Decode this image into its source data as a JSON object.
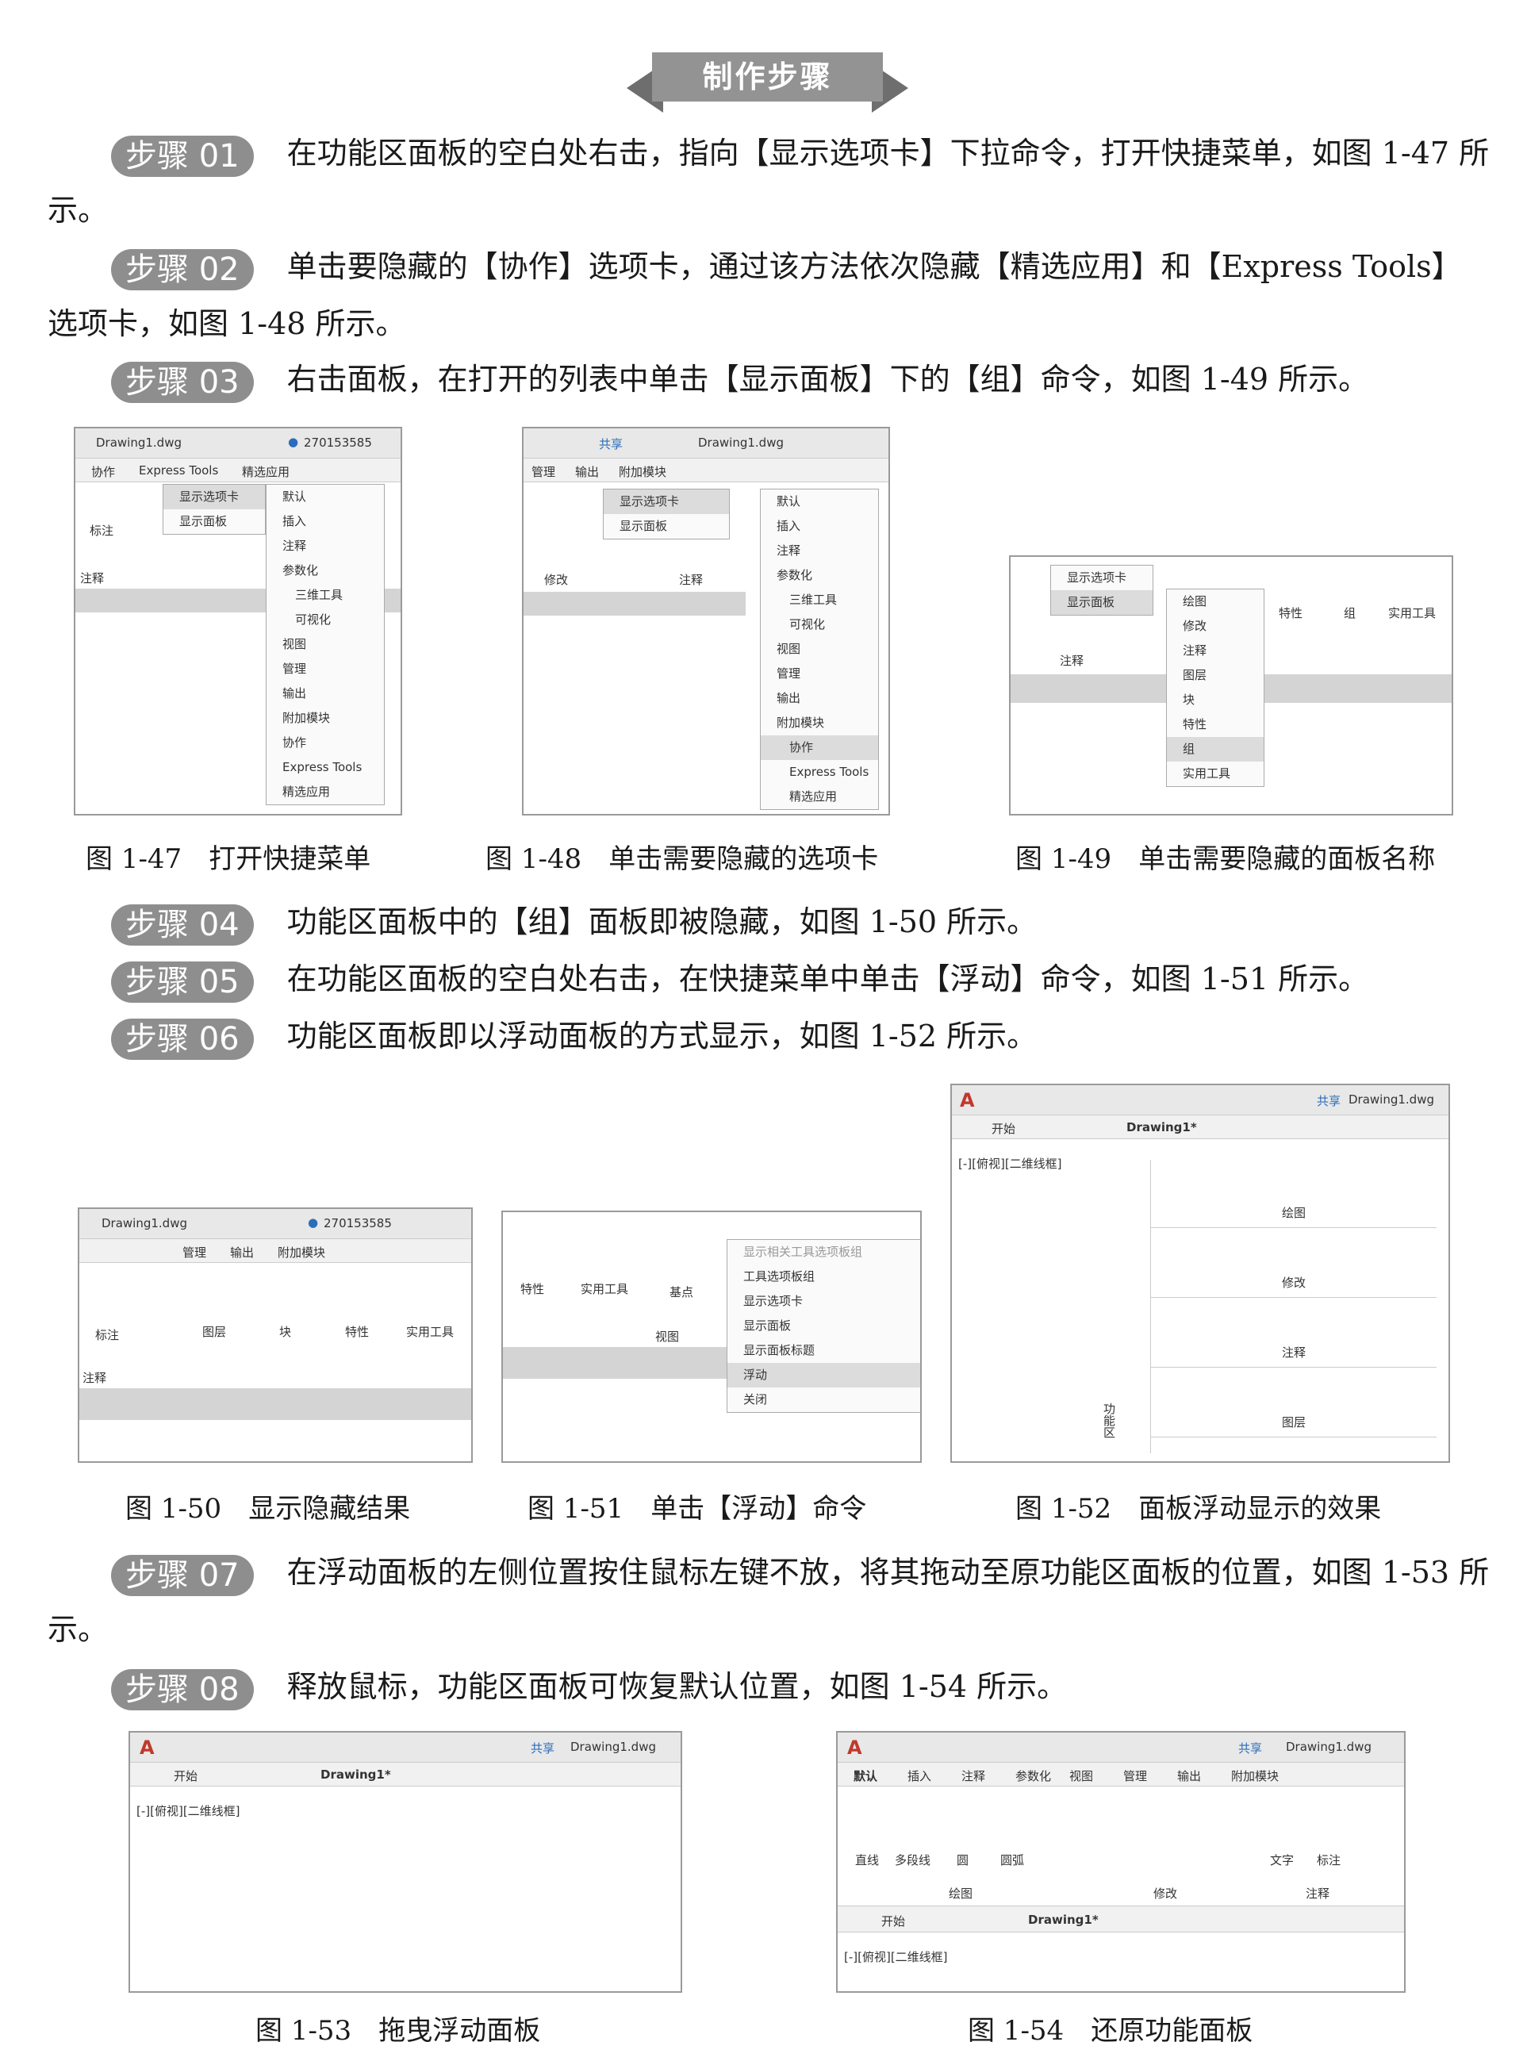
{
  "header": {
    "title": "制作步骤"
  },
  "steps": [
    {
      "badge": "步骤 01",
      "text": "在功能区面板的空白处右击，指向【显示选项卡】下拉命令，打开快捷菜单，如图 1-47 所示。"
    },
    {
      "badge": "步骤 02",
      "text": "单击要隐藏的【协作】选项卡，通过该方法依次隐藏【精选应用】和【Express Tools】选项卡，如图 1-48 所示。"
    },
    {
      "badge": "步骤 03",
      "text": "右击面板，在打开的列表中单击【显示面板】下的【组】命令，如图 1-49 所示。"
    },
    {
      "badge": "步骤 04",
      "text": "功能区面板中的【组】面板即被隐藏，如图 1-50 所示。"
    },
    {
      "badge": "步骤 05",
      "text": "在功能区面板的空白处右击，在快捷菜单中单击【浮动】命令，如图 1-51 所示。"
    },
    {
      "badge": "步骤 06",
      "text": "功能区面板即以浮动面板的方式显示，如图 1-52 所示。"
    },
    {
      "badge": "步骤 07",
      "text": "在浮动面板的左侧位置按住鼠标左键不放，将其拖动至原功能区面板的位置，如图 1-53 所示。"
    },
    {
      "badge": "步骤 08",
      "text": "释放鼠标，功能区面板可恢复默认位置，如图 1-54 所示。"
    }
  ],
  "captions": {
    "f47": "图 1-47　打开快捷菜单",
    "f48": "图 1-48　单击需要隐藏的选项卡",
    "f49": "图 1-49　单击需要隐藏的面板名称",
    "f50": "图 1-50　显示隐藏结果",
    "f51": "图 1-51　单击【浮动】命令",
    "f52": "图 1-52　面板浮动显示的效果",
    "f53": "图 1-53　拖曳浮动面板",
    "f54": "图 1-54　还原功能面板"
  },
  "ui": {
    "filename": "Drawing1.dwg",
    "user": "270153585",
    "share": "共享",
    "drawing_tab": "Drawing1*",
    "start_tab": "开始",
    "viewport": "[-][俯视][二维线框]",
    "tabs47": [
      "协作",
      "Express Tools",
      "精选应用"
    ],
    "tabs48": [
      "管理",
      "输出",
      "附加模块"
    ],
    "tabs54": [
      "默认",
      "插入",
      "注释",
      "参数化",
      "视图",
      "管理",
      "输出",
      "附加模块"
    ],
    "show_tabs": "显示选项卡",
    "show_panels": "显示面板",
    "menu47": [
      "默认",
      "插入",
      "注释",
      "参数化",
      "三维工具",
      "可视化",
      "视图",
      "管理",
      "输出",
      "附加模块",
      "协作",
      "Express Tools",
      "精选应用"
    ],
    "menu48": [
      "默认",
      "插入",
      "注释",
      "参数化",
      "三维工具",
      "可视化",
      "视图",
      "管理",
      "输出",
      "附加模块",
      "协作",
      "Express Tools",
      "精选应用"
    ],
    "menu49": [
      "绘图",
      "修改",
      "注释",
      "图层",
      "块",
      "特性",
      "组",
      "实用工具"
    ],
    "menu51": [
      "显示相关工具选项板组",
      "工具选项板组",
      "显示选项卡",
      "显示面板",
      "显示面板标题",
      "浮动",
      "关闭"
    ],
    "panels50": [
      "标注",
      "图层",
      "块",
      "特性",
      "实用工具"
    ],
    "panels51": [
      "特性",
      "实用工具",
      "基点",
      "视图"
    ],
    "panels49": [
      "特性",
      "组",
      "实用工具"
    ],
    "float_tabs": [
      "默认",
      "插入",
      "注释",
      "参数化",
      "视图"
    ],
    "float_panels": [
      "绘图",
      "修改",
      "注释",
      "图层"
    ],
    "label_annot": "注释",
    "label_modify": "修改",
    "label_mark": "标注",
    "tools54": [
      "直线",
      "多段线",
      "圆",
      "圆弧",
      "文字",
      "标注"
    ],
    "groups54": [
      "绘图",
      "修改",
      "注释"
    ],
    "side_label": "功能区"
  }
}
